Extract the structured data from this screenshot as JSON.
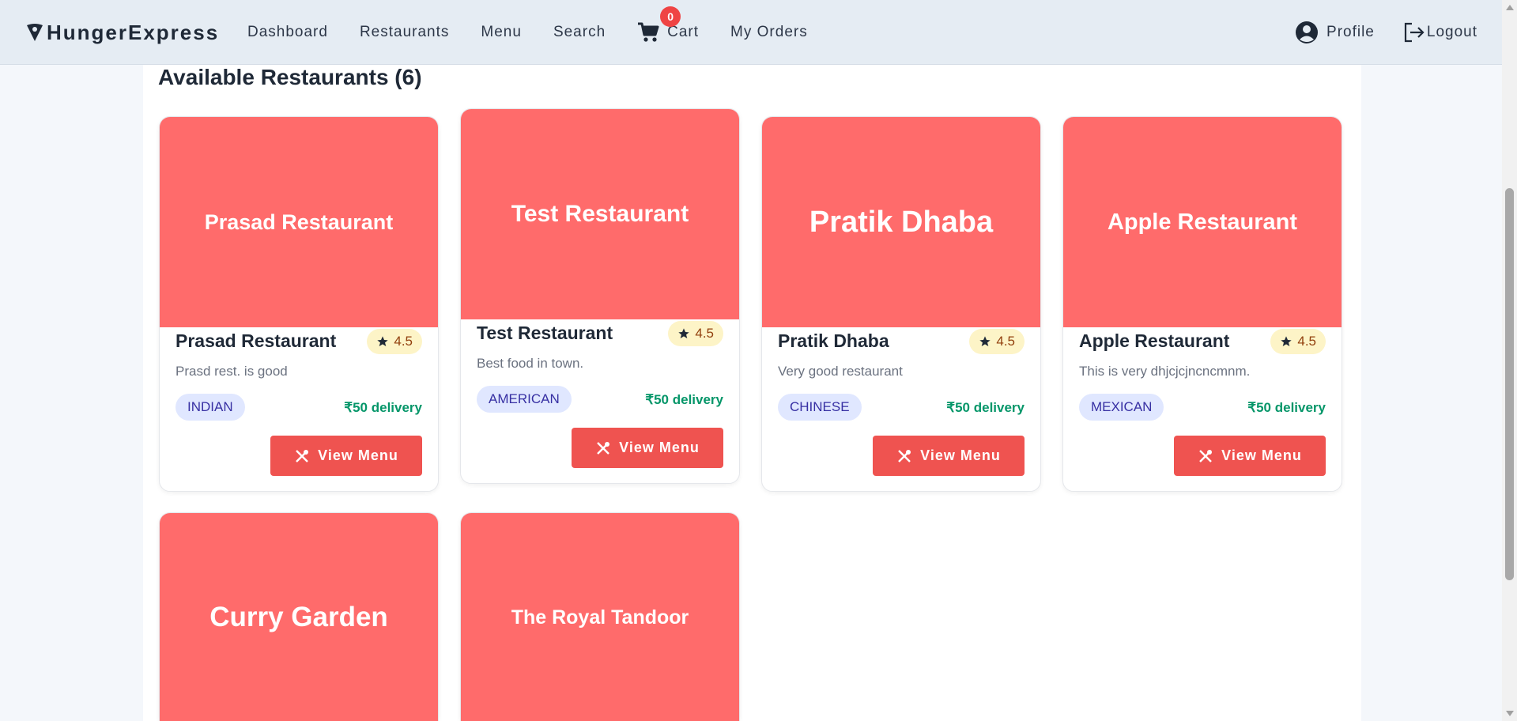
{
  "brand": {
    "name": "HungerExpress",
    "icon": "pizza-icon"
  },
  "nav": {
    "links": [
      "Dashboard",
      "Restaurants",
      "Menu",
      "Search"
    ],
    "cart_label": "Cart",
    "cart_count": "0",
    "my_orders": "My Orders",
    "profile": "Profile",
    "logout": "Logout"
  },
  "main": {
    "section_title": "Available Restaurants (6)"
  },
  "colors": {
    "card_image": "#ff6b6b",
    "button": "#ef5350",
    "accent_green": "#059669"
  },
  "restaurants": [
    {
      "name": "Prasad Restaurant",
      "rating": "4.5",
      "description": "Prasd rest. is good",
      "cuisine": "INDIAN",
      "delivery": "₹50 delivery",
      "button": "View Menu"
    },
    {
      "name": "Test Restaurant",
      "rating": "4.5",
      "description": "Best food in town.",
      "cuisine": "AMERICAN",
      "delivery": "₹50 delivery",
      "button": "View Menu"
    },
    {
      "name": "Pratik Dhaba",
      "rating": "4.5",
      "description": "Very good restaurant",
      "cuisine": "CHINESE",
      "delivery": "₹50 delivery",
      "button": "View Menu"
    },
    {
      "name": "Apple Restaurant",
      "rating": "4.5",
      "description": "This is very dhjcjcjncncmnm.",
      "cuisine": "MEXICAN",
      "delivery": "₹50 delivery",
      "button": "View Menu"
    },
    {
      "name": "Curry Garden"
    },
    {
      "name": "The Royal Tandoor"
    }
  ]
}
